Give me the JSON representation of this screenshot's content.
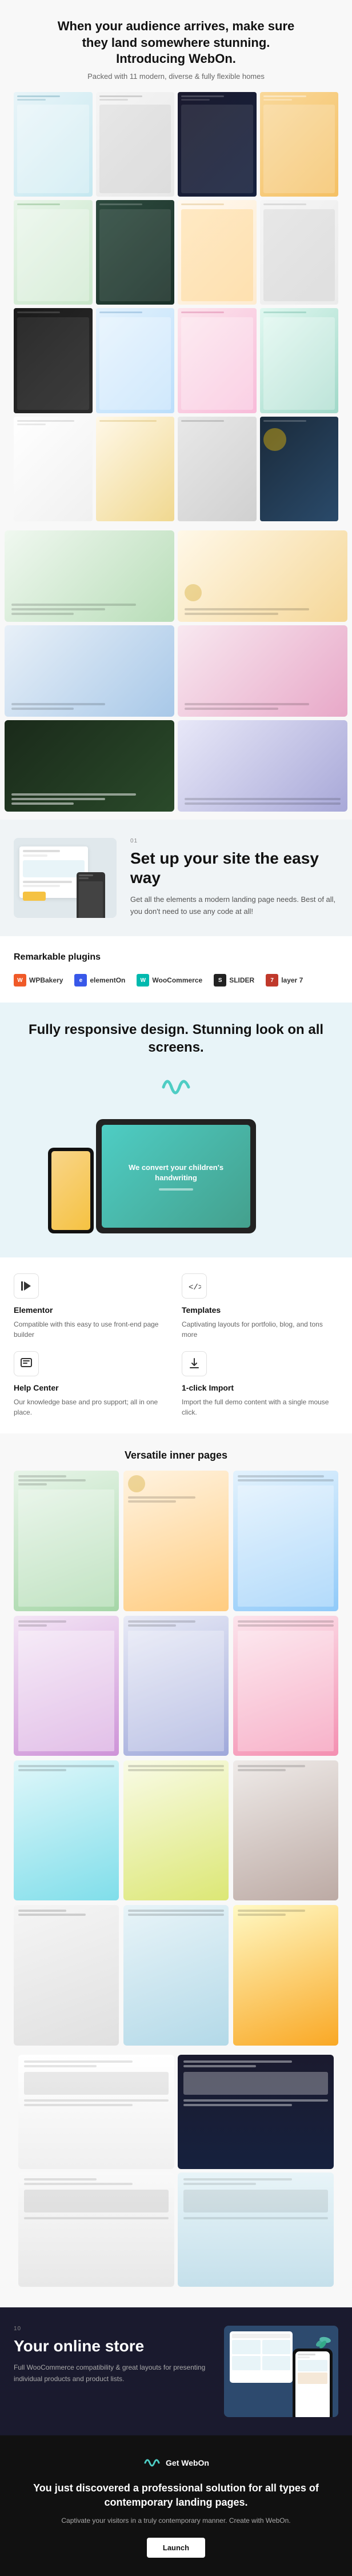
{
  "hero": {
    "title": "When your audience arrives, make sure they land somewhere stunning. Introducing WebOn.",
    "subtitle": "Packed with 11 modern, diverse & fully flexible homes"
  },
  "setup": {
    "label": "01",
    "title": "Set up your site the easy way",
    "description": "Get all the elements a modern landing page needs. Best of all, you don't need to use any code at all!"
  },
  "plugins": {
    "title": "Remarkable plugins",
    "items": [
      {
        "name": "WPBakery",
        "icon": "W"
      },
      {
        "name": "ElementsOn",
        "icon": "E"
      },
      {
        "name": "WooCommerce",
        "icon": "W"
      },
      {
        "name": "Slider",
        "icon": "S"
      },
      {
        "name": "Layer 7",
        "icon": "7"
      }
    ]
  },
  "responsive": {
    "title": "Fully responsive design. Stunning look on all screens.",
    "screen_text": "We convert your children's handwriting"
  },
  "features": {
    "items": [
      {
        "icon": "▶",
        "title": "Elementor",
        "description": "Compatible with this easy to use front-end page builder"
      },
      {
        "icon": "</>",
        "title": "Templates",
        "description": "Captivating layouts for portfolio, blog, and tons more"
      },
      {
        "icon": "?",
        "title": "Help Center",
        "description": "Our knowledge base and pro support; all in one place."
      },
      {
        "icon": "↑",
        "title": "1-click Import",
        "description": "Import the full demo content with a single mouse click."
      }
    ]
  },
  "inner_pages": {
    "title": "Versatile inner pages"
  },
  "store": {
    "label": "10",
    "title": "Your online store",
    "description": "Full WooCommerce compatibility & great layouts for presenting individual products and product lists."
  },
  "cta": {
    "logo": "WO",
    "brand": "Get WebOn",
    "title": "You just discovered a professional solution for all types of contemporary landing pages.",
    "description": "Captivate your visitors in a truly contemporary manner. Create with WebOn.",
    "button_label": "Launch"
  }
}
